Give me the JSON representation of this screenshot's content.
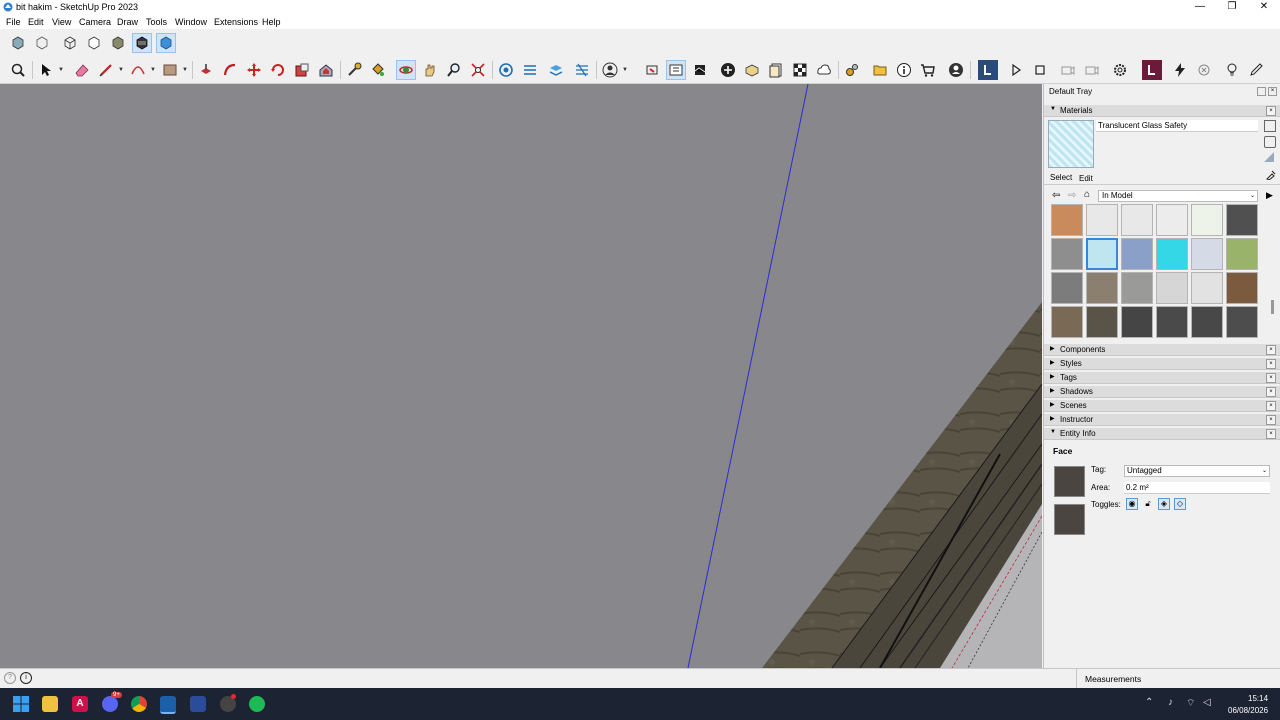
{
  "window": {
    "title": "bit hakim - SketchUp Pro 2023",
    "minimize": "—",
    "maximize": "❐",
    "close": "✕"
  },
  "menu": [
    "File",
    "Edit",
    "View",
    "Camera",
    "Draw",
    "Tools",
    "Window",
    "Extensions",
    "Help"
  ],
  "tray": {
    "title": "Default Tray",
    "materials": {
      "header": "Materials",
      "current_name": "Translucent Glass Safety",
      "tab_select": "Select",
      "tab_edit": "Edit",
      "library": "In Model",
      "swatches": [
        "#c98a5c",
        "#e8e8e8",
        "#e8e8e8",
        "#ececec",
        "#eef3ea",
        "#505050",
        "#8e8e8e",
        "#bfe6f0",
        "#8aa0c8",
        "#33d7e6",
        "#d4dbe6",
        "#9ab36a",
        "#7c7c7c",
        "#8b8070",
        "#9a9a98",
        "#d6d6d6",
        "#e2e2e2",
        "#7b5a3e",
        "#7a6a55",
        "#5a5448",
        "#454545",
        "#4a4a4a",
        "#484848",
        "#4d4d4d"
      ]
    },
    "collapsed_panels": [
      "Components",
      "Styles",
      "Tags",
      "Shadows",
      "Scenes",
      "Instructor"
    ],
    "entity_info": {
      "header": "Entity Info",
      "type": "Face",
      "tag_label": "Tag:",
      "tag_value": "Untagged",
      "area_label": "Area:",
      "area_value": "0.2 m²",
      "toggles_label": "Toggles:"
    }
  },
  "status": {
    "measurements_label": "Measurements"
  },
  "taskbar": {
    "time": "15:14",
    "date": "06/08/2026",
    "discord_badge": "9+"
  },
  "colors": {
    "viewport_bg": "#88888c",
    "axis_blue": "#2b2bd6",
    "accent_selected": "#3a86d4",
    "taskbar_bg": "#1c2333"
  }
}
